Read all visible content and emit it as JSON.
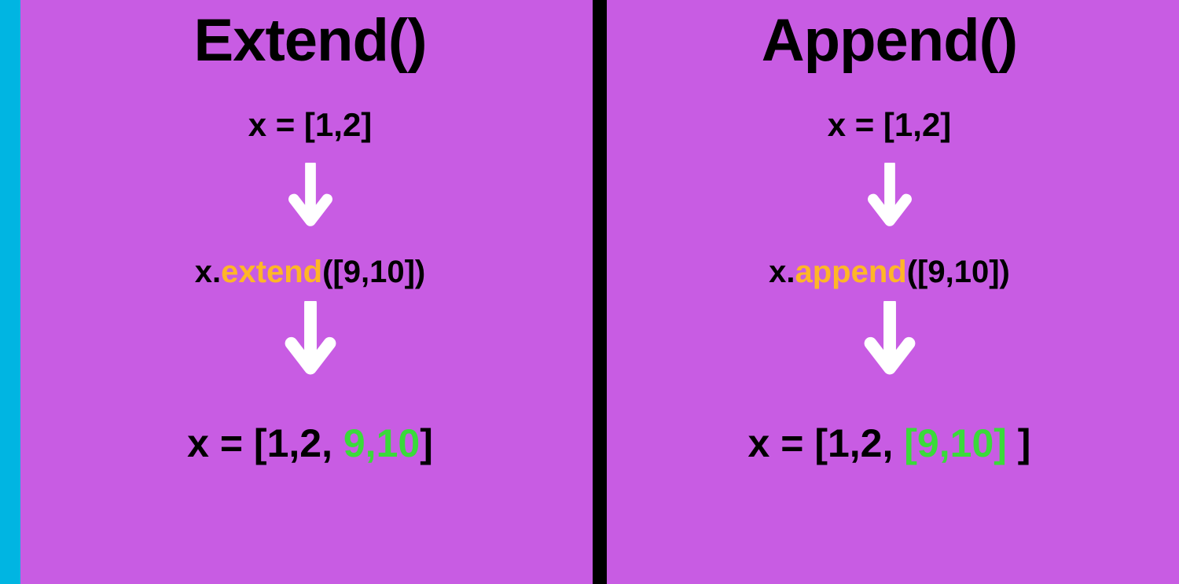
{
  "left": {
    "title": "Extend()",
    "init": "x = [1,2]",
    "call_prefix": "x.",
    "call_method": "extend",
    "call_suffix": "([9,10])",
    "result_prefix": "x = [1,2, ",
    "result_added": "9,10",
    "result_suffix": "]"
  },
  "right": {
    "title": "Append()",
    "init": "x = [1,2]",
    "call_prefix": "x.",
    "call_method": "append",
    "call_suffix": "([9,10])",
    "result_prefix": "x = [1,2, ",
    "result_added": "[9,10]",
    "result_suffix": " ]"
  }
}
